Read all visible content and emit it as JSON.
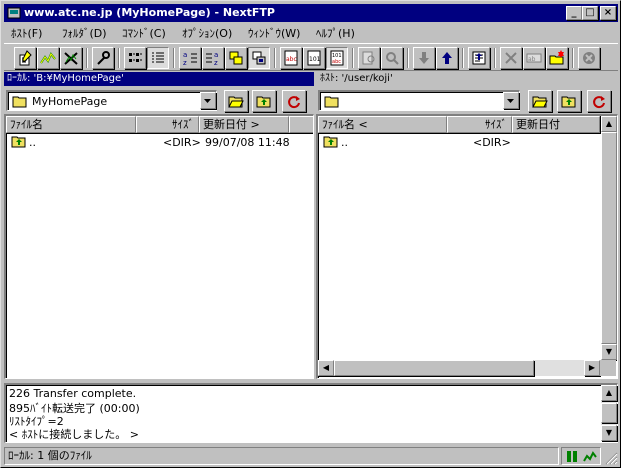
{
  "window": {
    "title": "www.atc.ne.jp (MyHomePage) - NextFTP",
    "minimize_glyph": "_",
    "maximize_glyph": "□",
    "close_glyph": "×"
  },
  "menu": [
    "ﾎｽﾄ(F)",
    "ﾌｫﾙﾀﾞ(D)",
    "ｺﾏﾝﾄﾞ(C)",
    "ｵﾌﾟｼｮﾝ(O)",
    "ｳｨﾝﾄﾞｳ(W)",
    "ﾍﾙﾌﾟ(H)"
  ],
  "toolbar_icons": [
    "connect-icon",
    "reconnect-icon",
    "disconnect-icon",
    "properties-icon",
    "large-icons-view-icon",
    "details-view-icon",
    "sort-ascending-icon",
    "sort-descending-icon",
    "sync-folder-icon",
    "mirror-icon",
    "ascii-mode-icon",
    "binary-mode-icon",
    "auto-mode-icon",
    "find-file-icon",
    "view-file-icon",
    "download-icon",
    "upload-icon",
    "edit-icon",
    "delete-icon",
    "rename-icon",
    "new-folder-icon",
    "stop-icon"
  ],
  "local": {
    "path_label": "ﾛｰｶﾙ: 'B:¥MyHomePage'",
    "combo_value": "MyHomePage",
    "columns": {
      "name": "ﾌｧｲﾙ名",
      "size": "ｻｲｽﾞ",
      "date": "更新日付 >"
    },
    "rows": [
      {
        "name": "..",
        "size": "<DIR>",
        "date": "99/07/08 11:48"
      }
    ]
  },
  "remote": {
    "path_label": "ﾎｽﾄ: '/user/koji'",
    "combo_value": "",
    "columns": {
      "name": "ﾌｧｲﾙ名 <",
      "size": "ｻｲｽﾞ",
      "date": "更新日付"
    },
    "rows": [
      {
        "name": "..",
        "size": "<DIR>",
        "date": ""
      }
    ]
  },
  "log_lines": [
    "226 Transfer complete.",
    "895ﾊﾞｲﾄ転送完了 (00:00)",
    "ﾘｽﾄﾀｲﾌﾟ=2",
    "< ﾎｽﾄに接続しました。 >"
  ],
  "status": {
    "text": "ﾛｰｶﾙ: 1 個のﾌｧｲﾙ"
  },
  "colors": {
    "titlebar": "#000080",
    "active_path": "#000080",
    "face": "#c0c0c0",
    "folder": "#f0e060"
  }
}
